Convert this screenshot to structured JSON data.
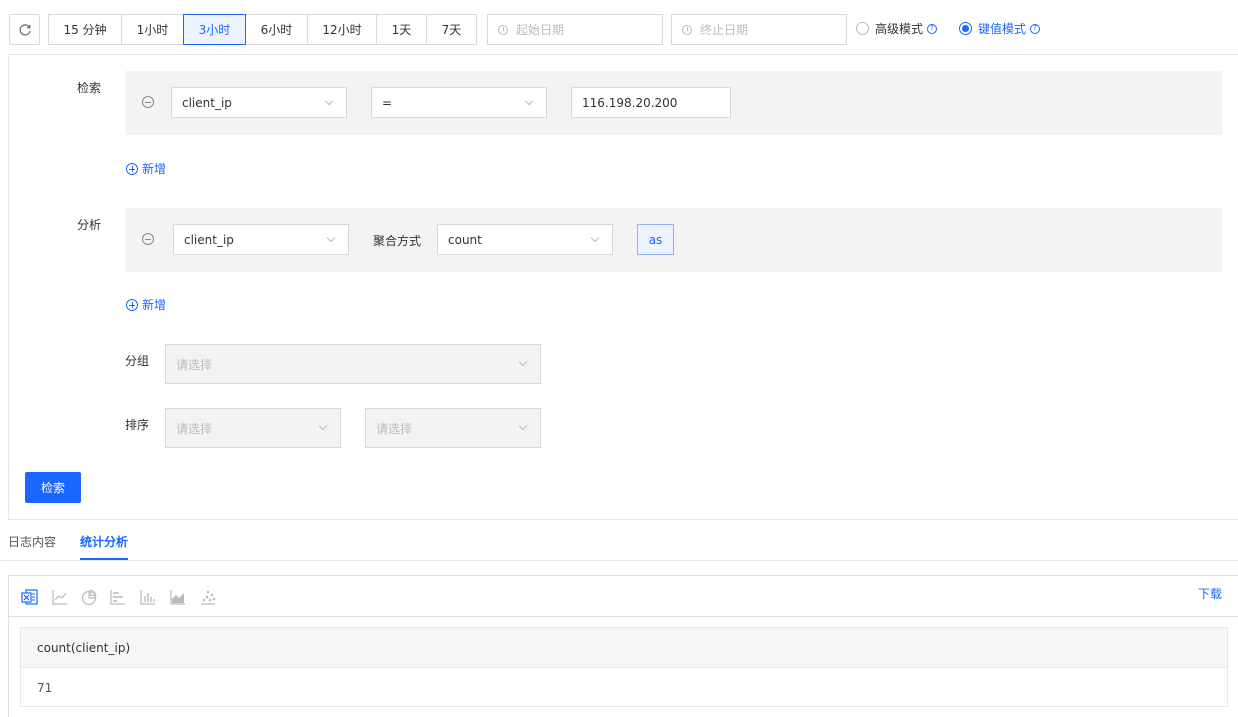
{
  "toolbar": {
    "time_ranges": [
      "15 分钟",
      "1小时",
      "3小时",
      "6小时",
      "12小时",
      "1天",
      "7天"
    ],
    "active_range": "3小时",
    "start_date_placeholder": "起始日期",
    "end_date_placeholder": "终止日期",
    "advanced_mode_label": "高级模式",
    "kv_mode_label": "键值模式",
    "help_glyph": "?"
  },
  "search": {
    "label": "检索",
    "field": "client_ip",
    "operator": "=",
    "value": "116.198.20.200",
    "add_label": "新增"
  },
  "analysis": {
    "label": "分析",
    "field": "client_ip",
    "agg_label": "聚合方式",
    "agg_value": "count",
    "as_label": "as",
    "add_label": "新增"
  },
  "group": {
    "label": "分组",
    "placeholder": "请选择"
  },
  "sort": {
    "label": "排序",
    "placeholder1": "请选择",
    "placeholder2": "请选择"
  },
  "search_button": "检索",
  "tabs": {
    "log_content": "日志内容",
    "stats": "统计分析"
  },
  "result": {
    "download_label": "下载",
    "tool_icons": [
      "excel-icon",
      "line-chart-icon",
      "pie-chart-icon",
      "bar-h-icon",
      "bar-chart-icon",
      "area-chart-icon",
      "scatter-icon"
    ],
    "column_header": "count(client_ip)",
    "cell_value": "71"
  },
  "colors": {
    "primary": "#1a66ff"
  }
}
